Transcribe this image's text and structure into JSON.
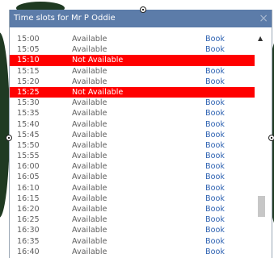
{
  "dialog": {
    "title": "Time slots for Mr P Oddie",
    "close_icon": "×"
  },
  "colors": {
    "titlebar": "#5c7ca9",
    "unavailable_row": "#ff0000",
    "link": "#2a5fb0"
  },
  "slots": [
    {
      "time": "15:00",
      "status": "Available",
      "book": "Book"
    },
    {
      "time": "15:05",
      "status": "Available",
      "book": "Book"
    },
    {
      "time": "15:10",
      "status": "Not Available",
      "book": ""
    },
    {
      "time": "15:15",
      "status": "Available",
      "book": "Book"
    },
    {
      "time": "15:20",
      "status": "Available",
      "book": "Book"
    },
    {
      "time": "15:25",
      "status": "Not Available",
      "book": ""
    },
    {
      "time": "15:30",
      "status": "Available",
      "book": "Book"
    },
    {
      "time": "15:35",
      "status": "Available",
      "book": "Book"
    },
    {
      "time": "15:40",
      "status": "Available",
      "book": "Book"
    },
    {
      "time": "15:45",
      "status": "Available",
      "book": "Book"
    },
    {
      "time": "15:50",
      "status": "Available",
      "book": "Book"
    },
    {
      "time": "15:55",
      "status": "Available",
      "book": "Book"
    },
    {
      "time": "16:00",
      "status": "Available",
      "book": "Book"
    },
    {
      "time": "16:05",
      "status": "Available",
      "book": "Book"
    },
    {
      "time": "16:10",
      "status": "Available",
      "book": "Book"
    },
    {
      "time": "16:15",
      "status": "Available",
      "book": "Book"
    },
    {
      "time": "16:20",
      "status": "Available",
      "book": "Book"
    },
    {
      "time": "16:25",
      "status": "Available",
      "book": "Book"
    },
    {
      "time": "16:30",
      "status": "Available",
      "book": "Book"
    },
    {
      "time": "16:35",
      "status": "Available",
      "book": "Book"
    },
    {
      "time": "16:40",
      "status": "Available",
      "book": "Book"
    }
  ]
}
